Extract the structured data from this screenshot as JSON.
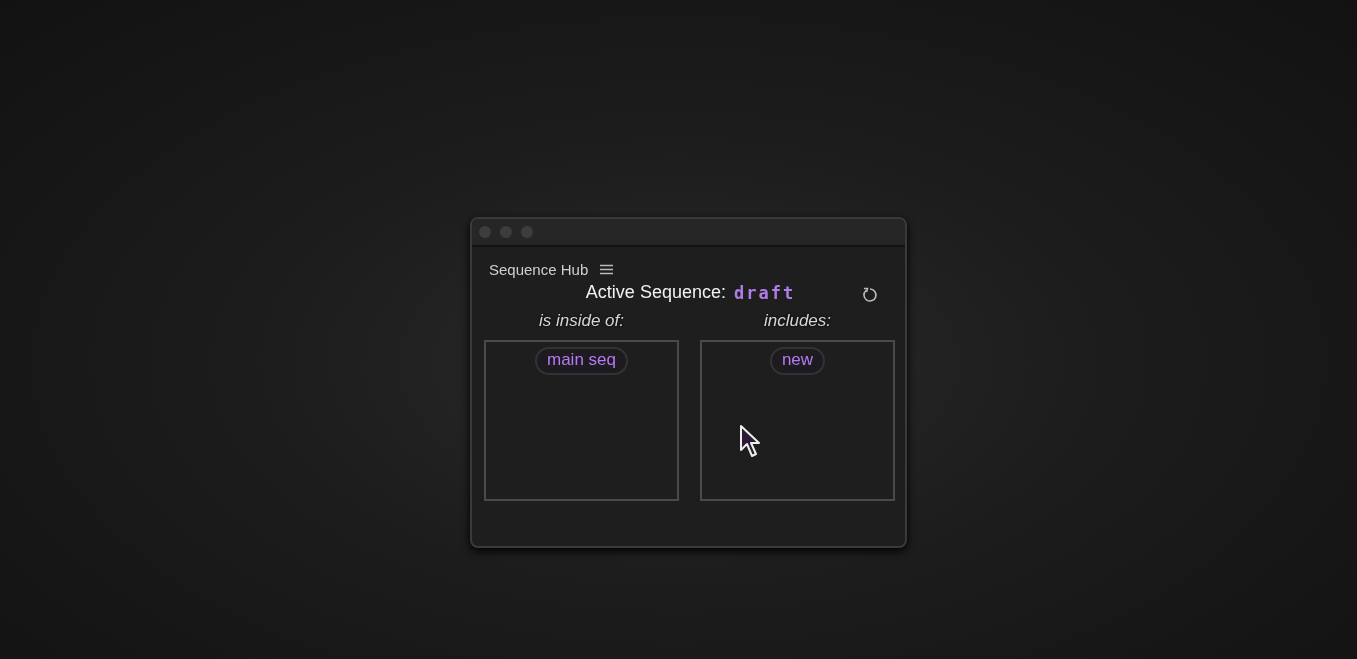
{
  "panel": {
    "title": "Sequence Hub"
  },
  "active_sequence": {
    "label": "Active Sequence:",
    "value": "draft"
  },
  "columns": [
    {
      "heading": "is inside of:",
      "items": [
        {
          "label": "main seq"
        }
      ]
    },
    {
      "heading": "includes:",
      "items": [
        {
          "label": "new"
        }
      ]
    }
  ]
}
